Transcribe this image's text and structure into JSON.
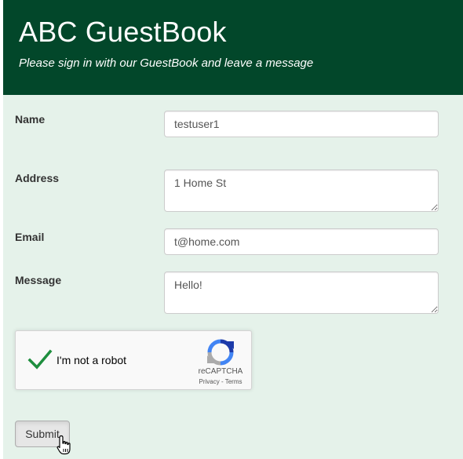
{
  "header": {
    "title": "ABC GuestBook",
    "subtitle": "Please sign in with our GuestBook and leave a message"
  },
  "form": {
    "name_label": "Name",
    "name_value": "testuser1",
    "address_label": "Address",
    "address_value": "1 Home St",
    "email_label": "Email",
    "email_value": "t@home.com",
    "message_label": "Message",
    "message_value": "Hello!",
    "submit_label": "Submit"
  },
  "captcha": {
    "label": "I'm not a robot",
    "brand": "reCAPTCHA",
    "links": "Privacy - Terms",
    "checked": true,
    "check_color": "#1e8e3e"
  },
  "colors": {
    "header_bg": "#02472a",
    "body_bg": "#e5f2ea"
  },
  "icons": {
    "captcha_check": "checkmark-icon",
    "captcha_logo": "recaptcha-logo-icon",
    "cursor": "hand-pointer-icon"
  }
}
